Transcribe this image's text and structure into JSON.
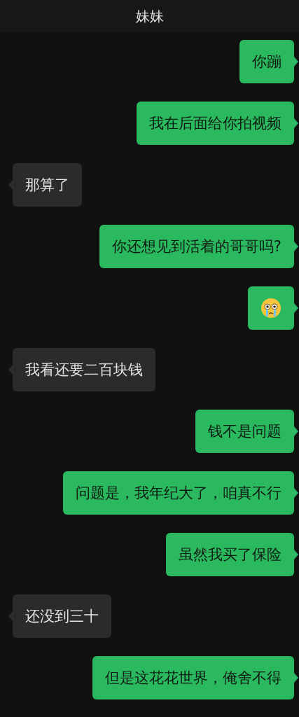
{
  "header": {
    "title": "妹妹"
  },
  "messages": [
    {
      "sent": true,
      "kind": "text",
      "text": "你蹦"
    },
    {
      "sent": true,
      "kind": "text",
      "text": "我在后面给你拍视频"
    },
    {
      "sent": false,
      "kind": "text",
      "text": "那算了"
    },
    {
      "sent": true,
      "kind": "text",
      "text": "你还想见到活着的哥哥吗?"
    },
    {
      "sent": true,
      "kind": "emoji"
    },
    {
      "sent": false,
      "kind": "text",
      "text": "我看还要二百块钱"
    },
    {
      "sent": true,
      "kind": "text",
      "text": "钱不是问题"
    },
    {
      "sent": true,
      "kind": "text",
      "text": "问题是，我年纪大了，咱真不行"
    },
    {
      "sent": true,
      "kind": "text",
      "text": "虽然我买了保险"
    },
    {
      "sent": false,
      "kind": "text",
      "text": "还没到三十"
    },
    {
      "sent": true,
      "kind": "text",
      "text": "但是这花花世界，俺舍不得"
    }
  ]
}
